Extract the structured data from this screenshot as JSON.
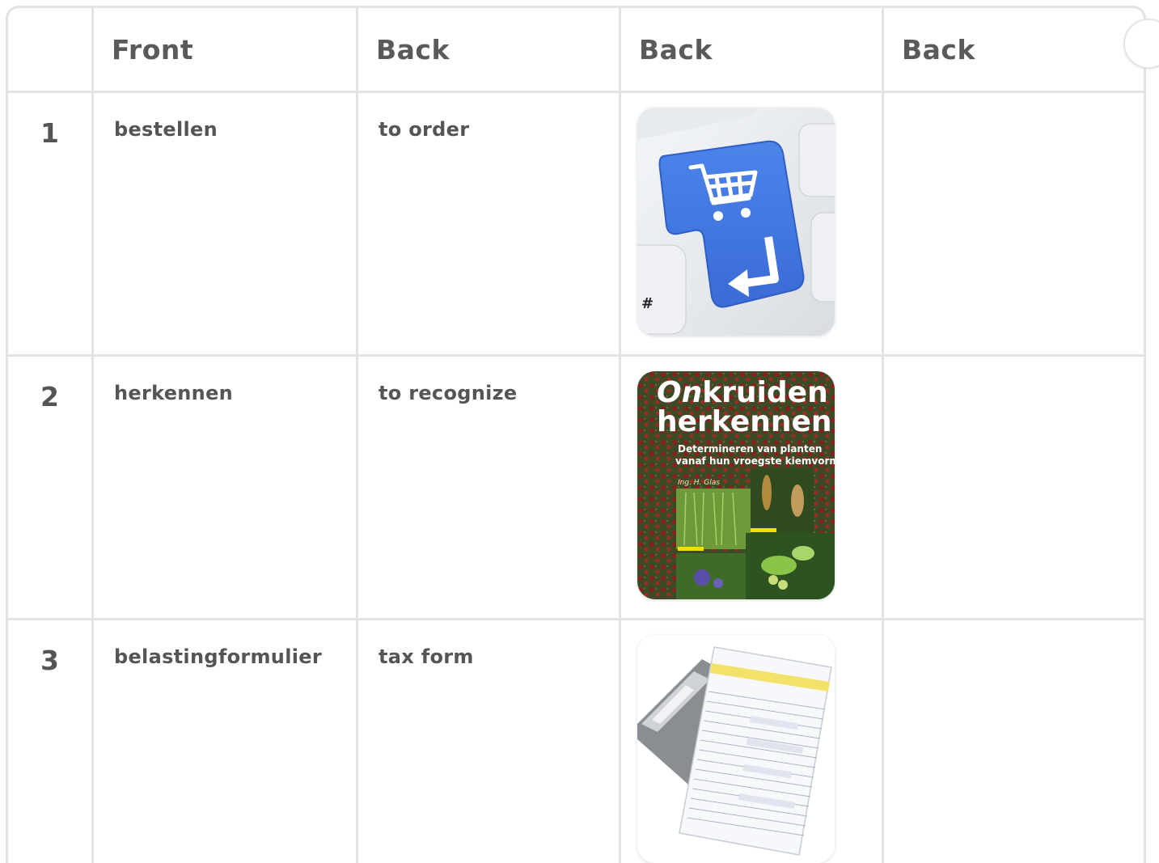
{
  "header": {
    "corner": "",
    "col1": "Front",
    "col2": "Back",
    "col3": "Back",
    "col4": "Back"
  },
  "rows": [
    {
      "num": "1",
      "front": "bestellen",
      "back": "to order",
      "image": "shopping-cart-enter-key-image"
    },
    {
      "num": "2",
      "front": "herkennen",
      "back": "to recognize",
      "image": "onkruiden-herkennen-book-cover",
      "cover": {
        "title_italic": "On",
        "title_rest": "kruiden",
        "title_line2": "herkennen",
        "subtitle_1": "Determineren van planten",
        "subtitle_2": "vanaf hun vroegste kiemvorm",
        "author": "Ing. H. Glas"
      }
    },
    {
      "num": "3",
      "front": "belastingformulier",
      "back": "tax form",
      "image": "tax-form-document-image"
    }
  ],
  "colors": {
    "border": "#e2e2e2",
    "key_blue": "#3f74e0",
    "cover_red": "#8b1e1e"
  }
}
